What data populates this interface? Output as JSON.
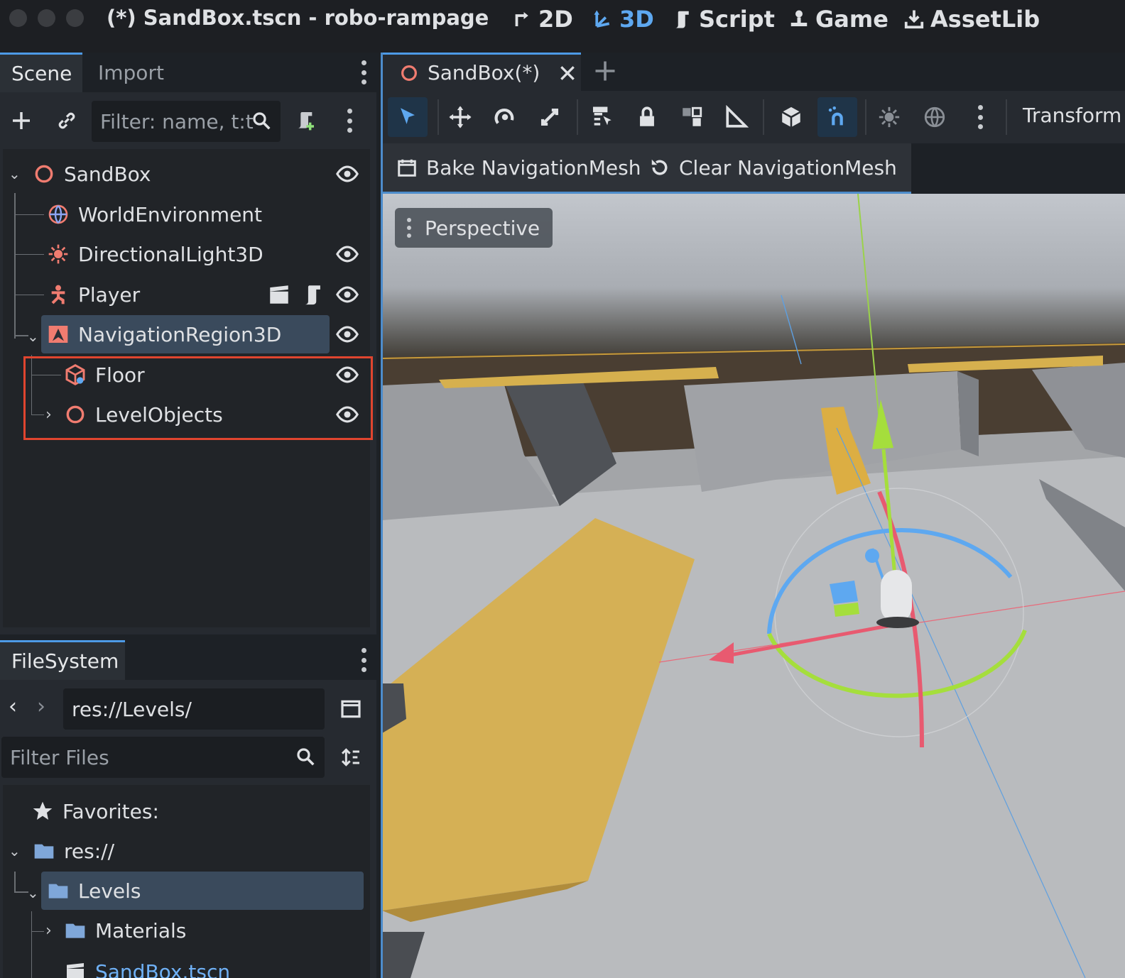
{
  "window": {
    "title": "(*) SandBox.tscn - robo-rampage",
    "workspaces": [
      {
        "label": "2D",
        "icon": "2d-icon",
        "active": false
      },
      {
        "label": "3D",
        "icon": "3d-icon",
        "active": true
      },
      {
        "label": "Script",
        "icon": "script-icon",
        "active": false
      },
      {
        "label": "Game",
        "icon": "game-icon",
        "active": false
      },
      {
        "label": "AssetLib",
        "icon": "assetlib-icon",
        "active": false
      }
    ]
  },
  "scene_dock": {
    "tabs": [
      "Scene",
      "Import"
    ],
    "filter_placeholder": "Filter: name, t:t",
    "nodes": [
      {
        "label": "SandBox",
        "icon": "node3d-icon",
        "visible_toggle": true
      },
      {
        "label": "WorldEnvironment",
        "icon": "world-environment-icon",
        "visible_toggle": false
      },
      {
        "label": "DirectionalLight3D",
        "icon": "directional-light-icon",
        "visible_toggle": true
      },
      {
        "label": "Player",
        "icon": "character-body-icon",
        "visible_toggle": true
      },
      {
        "label": "NavigationRegion3D",
        "icon": "navigation-region-icon",
        "visible_toggle": true,
        "selected": true
      },
      {
        "label": "Floor",
        "icon": "mesh-instance-icon",
        "visible_toggle": true
      },
      {
        "label": "LevelObjects",
        "icon": "node3d-icon",
        "visible_toggle": true
      }
    ]
  },
  "filesystem_dock": {
    "tab": "FileSystem",
    "path": "res://Levels/",
    "filter_placeholder": "Filter Files",
    "items": [
      {
        "label": "Favorites:",
        "icon": "star-icon"
      },
      {
        "label": "res://",
        "icon": "folder-icon"
      },
      {
        "label": "Levels",
        "icon": "folder-icon",
        "selected": true
      },
      {
        "label": "Materials",
        "icon": "folder-icon"
      },
      {
        "label": "SandBox.tscn",
        "icon": "scene-file-icon"
      }
    ]
  },
  "editor": {
    "scene_tab": "SandBox(*)",
    "toolbar_transform_label": "Transform",
    "bake_button": "Bake NavigationMesh",
    "clear_button": "Clear NavigationMesh",
    "perspective_label": "Perspective"
  },
  "colors": {
    "accent": "#5ea8f0",
    "node_red": "#f07c70",
    "highlight_box": "#e0452f",
    "selection": "#3a4a5c"
  }
}
